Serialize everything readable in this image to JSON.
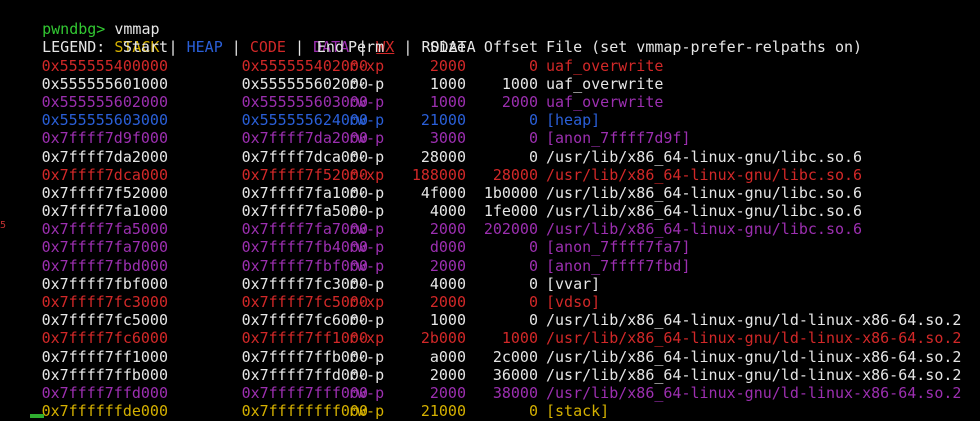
{
  "colors": {
    "background": "#000000",
    "default": "#e6e6e6",
    "green": "#32c832",
    "stack": "#d4b000",
    "heap": "#2a5fd8",
    "code": "#d22828",
    "data": "#9c2fb0",
    "rodata": "#e6e6e6"
  },
  "prompt": {
    "name": "pwndbg>",
    "command": " vmmap"
  },
  "legend": {
    "label": "LEGEND:",
    "stack": "STACK",
    "sep": " | ",
    "heap": "HEAP",
    "code": "CODE",
    "data": "DATA",
    "wx": "WX",
    "rodata": "RODATA"
  },
  "header": {
    "start": "Start",
    "end": "End",
    "perm": "Perm",
    "size": "Size",
    "offset": "Offset",
    "file": "File (set vmmap-prefer-relpaths on)"
  },
  "rows": [
    {
      "start": "0x555555400000",
      "end": "0x555555402000",
      "perm": "r-xp",
      "size": "2000",
      "offset": "0",
      "file": "uaf_overwrite",
      "kind": "code"
    },
    {
      "start": "0x555555601000",
      "end": "0x555555602000",
      "perm": "r--p",
      "size": "1000",
      "offset": "1000",
      "file": "uaf_overwrite",
      "kind": "rodata"
    },
    {
      "start": "0x555555602000",
      "end": "0x555555603000",
      "perm": "rw-p",
      "size": "1000",
      "offset": "2000",
      "file": "uaf_overwrite",
      "kind": "data"
    },
    {
      "start": "0x555555603000",
      "end": "0x555555624000",
      "perm": "rw-p",
      "size": "21000",
      "offset": "0",
      "file": "[heap]",
      "kind": "heap"
    },
    {
      "start": "0x7ffff7d9f000",
      "end": "0x7ffff7da2000",
      "perm": "rw-p",
      "size": "3000",
      "offset": "0",
      "file": "[anon_7ffff7d9f]",
      "kind": "data"
    },
    {
      "start": "0x7ffff7da2000",
      "end": "0x7ffff7dca000",
      "perm": "r--p",
      "size": "28000",
      "offset": "0",
      "file": "/usr/lib/x86_64-linux-gnu/libc.so.6",
      "kind": "rodata"
    },
    {
      "start": "0x7ffff7dca000",
      "end": "0x7ffff7f52000",
      "perm": "r-xp",
      "size": "188000",
      "offset": "28000",
      "file": "/usr/lib/x86_64-linux-gnu/libc.so.6",
      "kind": "code"
    },
    {
      "start": "0x7ffff7f52000",
      "end": "0x7ffff7fa1000",
      "perm": "r--p",
      "size": "4f000",
      "offset": "1b0000",
      "file": "/usr/lib/x86_64-linux-gnu/libc.so.6",
      "kind": "rodata"
    },
    {
      "start": "0x7ffff7fa1000",
      "end": "0x7ffff7fa5000",
      "perm": "r--p",
      "size": "4000",
      "offset": "1fe000",
      "file": "/usr/lib/x86_64-linux-gnu/libc.so.6",
      "kind": "rodata"
    },
    {
      "start": "0x7ffff7fa5000",
      "end": "0x7ffff7fa7000",
      "perm": "rw-p",
      "size": "2000",
      "offset": "202000",
      "file": "/usr/lib/x86_64-linux-gnu/libc.so.6",
      "kind": "data"
    },
    {
      "start": "0x7ffff7fa7000",
      "end": "0x7ffff7fb4000",
      "perm": "rw-p",
      "size": "d000",
      "offset": "0",
      "file": "[anon_7ffff7fa7]",
      "kind": "data"
    },
    {
      "start": "0x7ffff7fbd000",
      "end": "0x7ffff7fbf000",
      "perm": "rw-p",
      "size": "2000",
      "offset": "0",
      "file": "[anon_7ffff7fbd]",
      "kind": "data"
    },
    {
      "start": "0x7ffff7fbf000",
      "end": "0x7ffff7fc3000",
      "perm": "r--p",
      "size": "4000",
      "offset": "0",
      "file": "[vvar]",
      "kind": "rodata"
    },
    {
      "start": "0x7ffff7fc3000",
      "end": "0x7ffff7fc5000",
      "perm": "r-xp",
      "size": "2000",
      "offset": "0",
      "file": "[vdso]",
      "kind": "code"
    },
    {
      "start": "0x7ffff7fc5000",
      "end": "0x7ffff7fc6000",
      "perm": "r--p",
      "size": "1000",
      "offset": "0",
      "file": "/usr/lib/x86_64-linux-gnu/ld-linux-x86-64.so.2",
      "kind": "rodata"
    },
    {
      "start": "0x7ffff7fc6000",
      "end": "0x7ffff7ff1000",
      "perm": "r-xp",
      "size": "2b000",
      "offset": "1000",
      "file": "/usr/lib/x86_64-linux-gnu/ld-linux-x86-64.so.2",
      "kind": "code"
    },
    {
      "start": "0x7ffff7ff1000",
      "end": "0x7ffff7ffb000",
      "perm": "r--p",
      "size": "a000",
      "offset": "2c000",
      "file": "/usr/lib/x86_64-linux-gnu/ld-linux-x86-64.so.2",
      "kind": "rodata"
    },
    {
      "start": "0x7ffff7ffb000",
      "end": "0x7ffff7ffd000",
      "perm": "r--p",
      "size": "2000",
      "offset": "36000",
      "file": "/usr/lib/x86_64-linux-gnu/ld-linux-x86-64.so.2",
      "kind": "rodata"
    },
    {
      "start": "0x7ffff7ffd000",
      "end": "0x7ffff7fff000",
      "perm": "rw-p",
      "size": "2000",
      "offset": "38000",
      "file": "/usr/lib/x86_64-linux-gnu/ld-linux-x86-64.so.2",
      "kind": "data"
    },
    {
      "start": "0x7ffffffde000",
      "end": "0x7ffffffff000",
      "perm": "rw-p",
      "size": "21000",
      "offset": "0",
      "file": "[stack]",
      "kind": "stack"
    }
  ]
}
